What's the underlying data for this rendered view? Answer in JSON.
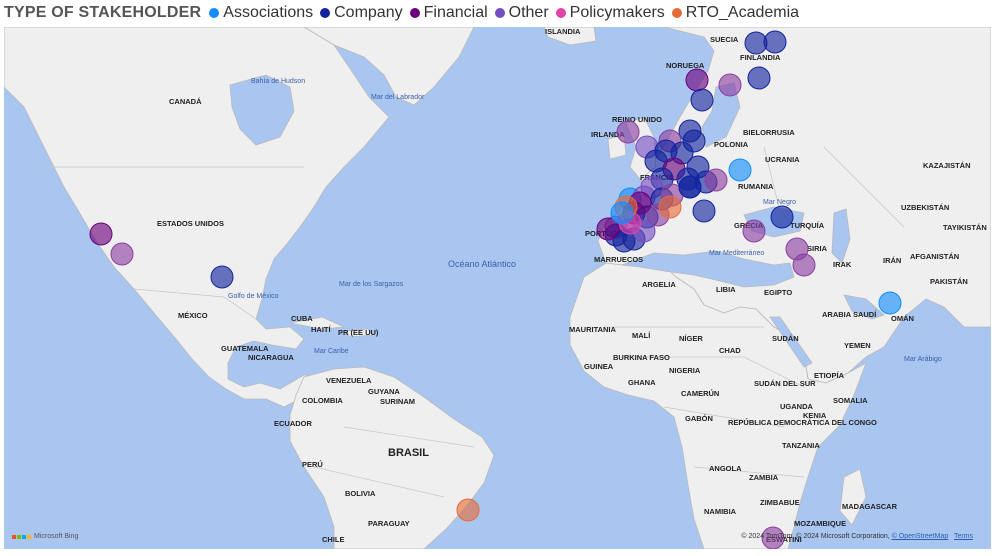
{
  "legend": {
    "title": "TYPE OF STAKEHOLDER",
    "items": [
      {
        "label": "Associations",
        "color": "#118dff"
      },
      {
        "label": "Company",
        "color": "#12239e"
      },
      {
        "label": "Financial",
        "color": "#6b007b"
      },
      {
        "label": "Other",
        "color": "#744ec2"
      },
      {
        "label": "Policymakers",
        "color": "#e044a7"
      },
      {
        "label": "RTO_Academia",
        "color": "#e66c37"
      }
    ]
  },
  "map": {
    "colors": {
      "water": "#a9c6f1",
      "land": "#efefef",
      "border": "#b9b9b9"
    },
    "bubble_colors": {
      "Associations": "#118dff",
      "Company": "#12239e",
      "Financial": "#6b007b",
      "Other": "#744ec2",
      "Policymakers": "#e044a7",
      "RTO_Academia": "#e66c37",
      "Mixed": "#8a3fa0"
    },
    "country_labels": [
      "CANADÁ",
      "ESTADOS UNIDOS",
      "MÉXICO",
      "CUBA",
      "HAITÍ",
      "PR (EE UU)",
      "GUATEMALA",
      "NICARAGUA",
      "VENEZUELA",
      "GUYANA",
      "SURINAM",
      "COLOMBIA",
      "ECUADOR",
      "PERÚ",
      "BRASIL",
      "BOLIVIA",
      "PARAGUAY",
      "CHILE",
      "ISLANDIA",
      "SUECIA",
      "NORUEGA",
      "FINLANDIA",
      "REINO UNIDO",
      "IRLANDA",
      "BIELORRUSIA",
      "POLONIA",
      "UCRANIA",
      "RUMANIA",
      "FRANCIA",
      "PORTUGAL",
      "GRECIA",
      "TURQUÍA",
      "SIRIA",
      "IRAK",
      "IRÁN",
      "AFGANISTÁN",
      "PAKISTÁN",
      "KAZAJISTÁN",
      "UZBEKISTÁN",
      "TAYIKISTÁN",
      "ARABIA SAUDÍ",
      "OMÁN",
      "YEMEN",
      "EGIPTO",
      "LIBIA",
      "ARGELIA",
      "MARRUECOS",
      "MAURITANIA",
      "MALÍ",
      "NÍGER",
      "CHAD",
      "SUDÁN",
      "SUDÁN DEL SUR",
      "ETIOPÍA",
      "SOMALIA",
      "KENIA",
      "UGANDA",
      "TANZANIA",
      "REPÚBLICA DEMOCRÁTICA DEL CONGO",
      "GABÓN",
      "CAMERÚN",
      "NIGERIA",
      "GHANA",
      "BURKINA FASO",
      "GUINEA",
      "ANGOLA",
      "ZAMBIA",
      "ZIMBABUE",
      "NAMIBIA",
      "MOZAMBIQUE",
      "MADAGASCAR",
      "ESWATINI"
    ],
    "water_labels": [
      "Bahía de Hudson",
      "Mar del Labrador",
      "Golfo de México",
      "Mar de los Sargazos",
      "Mar Caribe",
      "Océano Atlántico",
      "Mar Mediterráneo",
      "Mar Negro",
      "Mar Arábigo"
    ]
  },
  "attribution": {
    "text": "© 2024 TomTom, © 2024 Microsoft Corporation,",
    "osm": "© OpenStreetMap",
    "terms": "Terms"
  },
  "bing": {
    "label": "Microsoft Bing"
  }
}
